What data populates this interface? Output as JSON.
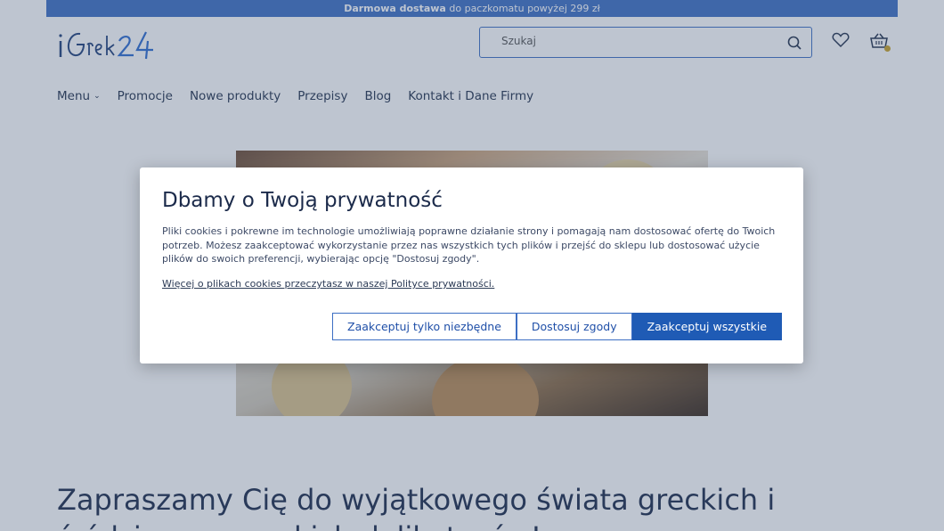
{
  "topbar": {
    "bold": "Darmowa dostawa",
    "text": " do paczkomatu powyżej 299 zł"
  },
  "header": {
    "logo_text": "iGrek24",
    "search_placeholder": "Szukaj"
  },
  "nav": {
    "items": [
      {
        "label": "Menu"
      },
      {
        "label": "Promocje"
      },
      {
        "label": "Nowe produkty"
      },
      {
        "label": "Przepisy"
      },
      {
        "label": "Blog"
      },
      {
        "label": "Kontakt i Dane Firmy"
      }
    ]
  },
  "main": {
    "heading": "Zapraszamy Cię do wyjątkowego świata greckich i śródziemnomorskich delikatesów!"
  },
  "cookie_modal": {
    "title": "Dbamy o Twoją prywatność",
    "description": "Pliki cookies i pokrewne im technologie umożliwiają poprawne działanie strony i pomagają nam dostosować ofertę do Twoich potrzeb. Możesz zaakceptować wykorzystanie przez nas wszystkich tych plików i przejść do sklepu lub dostosować użycie plików do swoich preferencji, wybierając opcję \"Dostosuj zgody\".",
    "policy_link": "Więcej o plikach cookies przeczytasz w naszej Polityce prywatności.",
    "btn_necessary": "Zaakceptuj tylko niezbędne",
    "btn_customize": "Dostosuj zgody",
    "btn_accept_all": "Zaakceptuj wszystkie"
  },
  "colors": {
    "accent": "#1f5bb5",
    "topbar": "#3d6fc4"
  }
}
